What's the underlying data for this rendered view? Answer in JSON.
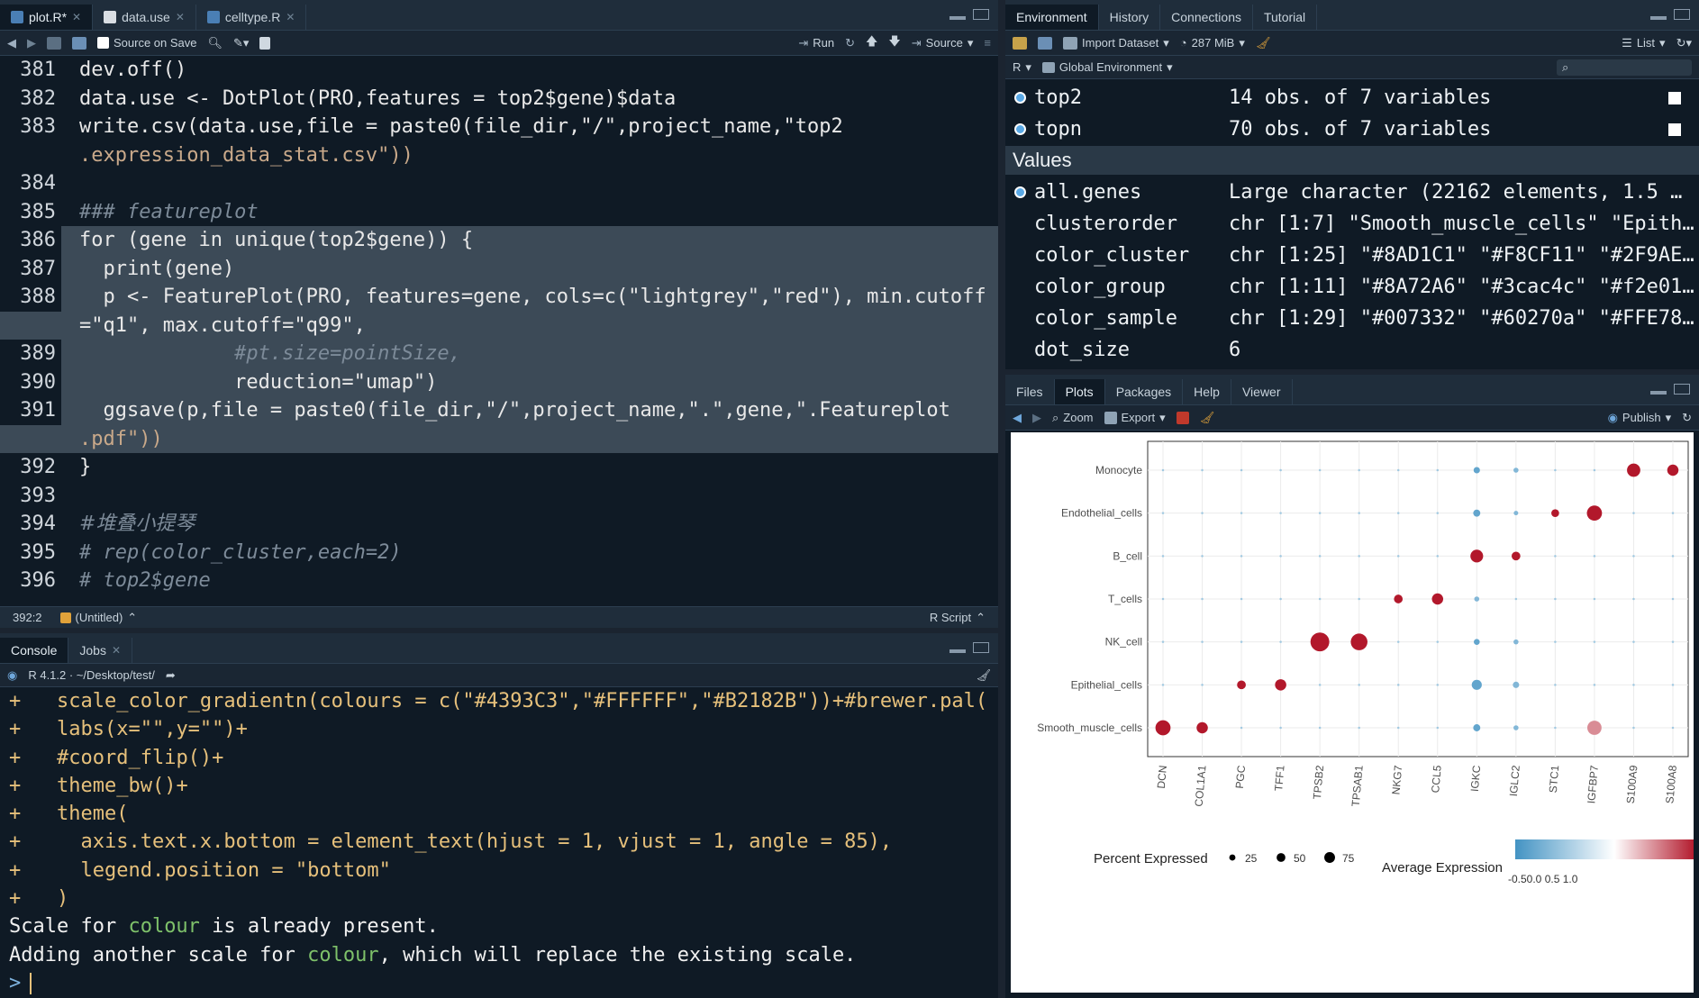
{
  "editor": {
    "tabs": [
      {
        "label": "plot.R*"
      },
      {
        "label": "data.use"
      },
      {
        "label": "celltype.R"
      }
    ],
    "toolbar": {
      "source_on_save": "Source on Save",
      "run": "Run",
      "source": "Source"
    },
    "lines": [
      {
        "n": "381",
        "text": "dev.off()"
      },
      {
        "n": "382",
        "text": "data.use <- DotPlot(PRO,features = top2$gene)$data"
      },
      {
        "n": "383",
        "text": "write.csv(data.use,file = paste0(file_dir,\"/\",project_name,\"top2"
      },
      {
        "n": "",
        "text": ".expression_data_stat.csv\"))"
      },
      {
        "n": "384",
        "text": ""
      },
      {
        "n": "385",
        "text": "### featureplot"
      },
      {
        "n": "386",
        "text": "for (gene in unique(top2$gene)) {"
      },
      {
        "n": "387",
        "text": "  print(gene)"
      },
      {
        "n": "388",
        "text": "  p <- FeaturePlot(PRO, features=gene, cols=c(\"lightgrey\",\"red\"), min.cutoff"
      },
      {
        "n": "",
        "text": "=\"q1\", max.cutoff=\"q99\","
      },
      {
        "n": "389",
        "text": "             #pt.size=pointSize,"
      },
      {
        "n": "390",
        "text": "             reduction=\"umap\")"
      },
      {
        "n": "391",
        "text": "  ggsave(p,file = paste0(file_dir,\"/\",project_name,\".\",gene,\".Featureplot"
      },
      {
        "n": "",
        "text": ".pdf\"))"
      },
      {
        "n": "392",
        "text": "}"
      },
      {
        "n": "393",
        "text": ""
      },
      {
        "n": "394",
        "text": "#堆叠小提琴"
      },
      {
        "n": "395",
        "text": "# rep(color_cluster,each=2)"
      },
      {
        "n": "396",
        "text": "# top2$gene"
      }
    ],
    "status": {
      "position": "392:2",
      "scope": "(Untitled)",
      "filetype": "R Script"
    }
  },
  "console": {
    "tabs": [
      {
        "label": "Console"
      },
      {
        "label": "Jobs"
      }
    ],
    "header": "R 4.1.2 · ~/Desktop/test/",
    "lines": [
      "  scale_color_gradientn(colours = c(\"#4393C3\",\"#FFFFFF\",\"#B2182B\"))+#brewer.pal(",
      "  labs(x=\"\",y=\"\")+",
      "  #coord_flip()+",
      "  theme_bw()+",
      "  theme(",
      "    axis.text.x.bottom = element_text(hjust = 1, vjust = 1, angle = 85),",
      "    legend.position = \"bottom\"",
      "  )"
    ],
    "msg1": [
      "Scale for ",
      "colour",
      " is already present."
    ],
    "msg2": [
      "Adding another scale for ",
      "colour",
      ", which will replace the existing scale."
    ],
    "prompt": ">"
  },
  "environment": {
    "tabs": [
      {
        "label": "Environment"
      },
      {
        "label": "History"
      },
      {
        "label": "Connections"
      },
      {
        "label": "Tutorial"
      }
    ],
    "toolbar": {
      "import": "Import Dataset",
      "memory": "287 MiB",
      "view": "List"
    },
    "scope": {
      "lang": "R",
      "env": "Global Environment"
    },
    "data_rows": [
      {
        "name": "top2",
        "value": "14 obs. of 7 variables"
      },
      {
        "name": "topn",
        "value": "70 obs. of 7 variables"
      }
    ],
    "values_header": "Values",
    "value_rows": [
      {
        "name": "all.genes",
        "value": "Large character (22162 elements,  1.5 …",
        "dot": true
      },
      {
        "name": "clusterorder",
        "value": "chr [1:7] \"Smooth_muscle_cells\" \"Epith…",
        "dot": false
      },
      {
        "name": "color_cluster",
        "value": "chr [1:25] \"#8AD1C1\" \"#F8CF11\" \"#2F9AE…",
        "dot": false
      },
      {
        "name": "color_group",
        "value": "chr [1:11] \"#8A72A6\" \"#3cac4c\" \"#f2e01…",
        "dot": false
      },
      {
        "name": "color_sample",
        "value": "chr [1:29] \"#007332\" \"#60270a\" \"#FFE78…",
        "dot": false
      },
      {
        "name": "dot_size",
        "value": "6",
        "dot": false
      }
    ]
  },
  "plots_pane": {
    "tabs": [
      {
        "label": "Files"
      },
      {
        "label": "Plots"
      },
      {
        "label": "Packages"
      },
      {
        "label": "Help"
      },
      {
        "label": "Viewer"
      }
    ],
    "toolbar": {
      "zoom": "Zoom",
      "export": "Export",
      "publish": "Publish"
    }
  },
  "chart_data": {
    "type": "scatter",
    "genes": [
      "DCN",
      "COL1A1",
      "PGC",
      "TFF1",
      "TPSB2",
      "TPSAB1",
      "NKG7",
      "CCL5",
      "IGKC",
      "IGLC2",
      "STC1",
      "IGFBP7",
      "S100A9",
      "S100A8"
    ],
    "cell_types": [
      "Monocyte",
      "Endothelial_cells",
      "B_cell",
      "T_cells",
      "NK_cell",
      "Epithelial_cells",
      "Smooth_muscle_cells"
    ],
    "points": [
      {
        "cell": "Monocyte",
        "gene": "IGKC",
        "pct": 8,
        "avg": -0.5
      },
      {
        "cell": "Monocyte",
        "gene": "IGLC2",
        "pct": 5,
        "avg": -0.4
      },
      {
        "cell": "Monocyte",
        "gene": "S100A9",
        "pct": 35,
        "avg": 2.0
      },
      {
        "cell": "Monocyte",
        "gene": "S100A8",
        "pct": 25,
        "avg": 2.0
      },
      {
        "cell": "Endothelial_cells",
        "gene": "IGKC",
        "pct": 10,
        "avg": -0.5
      },
      {
        "cell": "Endothelial_cells",
        "gene": "IGLC2",
        "pct": 4,
        "avg": -0.4
      },
      {
        "cell": "Endothelial_cells",
        "gene": "STC1",
        "pct": 12,
        "avg": 2.0
      },
      {
        "cell": "Endothelial_cells",
        "gene": "IGFBP7",
        "pct": 45,
        "avg": 1.0
      },
      {
        "cell": "B_cell",
        "gene": "IGKC",
        "pct": 32,
        "avg": 2.0
      },
      {
        "cell": "B_cell",
        "gene": "IGLC2",
        "pct": 15,
        "avg": 2.0
      },
      {
        "cell": "T_cells",
        "gene": "NKG7",
        "pct": 15,
        "avg": 2.0
      },
      {
        "cell": "T_cells",
        "gene": "CCL5",
        "pct": 25,
        "avg": 2.0
      },
      {
        "cell": "T_cells",
        "gene": "IGKC",
        "pct": 5,
        "avg": -0.4
      },
      {
        "cell": "NK_cell",
        "gene": "TPSB2",
        "pct": 70,
        "avg": 2.0
      },
      {
        "cell": "NK_cell",
        "gene": "TPSAB1",
        "pct": 55,
        "avg": 2.0
      },
      {
        "cell": "NK_cell",
        "gene": "IGKC",
        "pct": 7,
        "avg": -0.5
      },
      {
        "cell": "NK_cell",
        "gene": "IGLC2",
        "pct": 5,
        "avg": -0.4
      },
      {
        "cell": "Epithelial_cells",
        "gene": "PGC",
        "pct": 15,
        "avg": 2.0
      },
      {
        "cell": "Epithelial_cells",
        "gene": "TFF1",
        "pct": 25,
        "avg": 2.0
      },
      {
        "cell": "Epithelial_cells",
        "gene": "IGKC",
        "pct": 20,
        "avg": -0.5
      },
      {
        "cell": "Epithelial_cells",
        "gene": "IGLC2",
        "pct": 8,
        "avg": -0.4
      },
      {
        "cell": "Smooth_muscle_cells",
        "gene": "DCN",
        "pct": 45,
        "avg": 2.0
      },
      {
        "cell": "Smooth_muscle_cells",
        "gene": "COL1A1",
        "pct": 25,
        "avg": 2.0
      },
      {
        "cell": "Smooth_muscle_cells",
        "gene": "IGKC",
        "pct": 10,
        "avg": -0.5
      },
      {
        "cell": "Smooth_muscle_cells",
        "gene": "IGLC2",
        "pct": 5,
        "avg": -0.4
      },
      {
        "cell": "Smooth_muscle_cells",
        "gene": "IGFBP7",
        "pct": 40,
        "avg": 0.5
      }
    ],
    "background_pct": 1,
    "background_avg": -0.3,
    "legend_size_title": "Percent Expressed",
    "legend_size_values": [
      25,
      50,
      75
    ],
    "legend_color_title": "Average Expression",
    "legend_color_ticks": "-0.50.0 0.5 1.0",
    "colors": {
      "low": "#4393C3",
      "mid": "#FFFFFF",
      "high": "#B2182B"
    }
  }
}
